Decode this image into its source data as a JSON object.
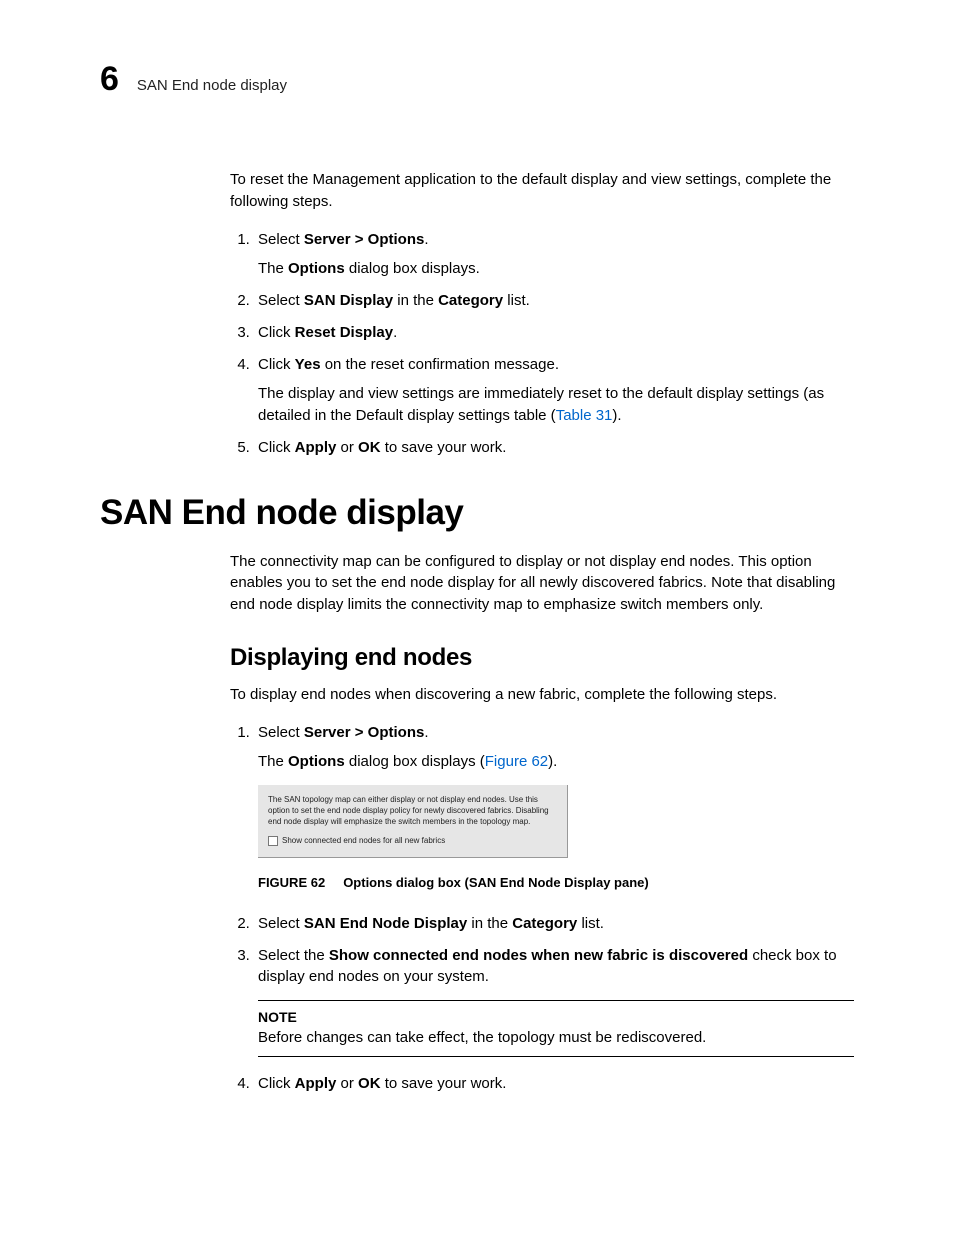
{
  "header": {
    "chapter_number": "6",
    "chapter_title": "SAN End node display"
  },
  "intro_para": "To reset the Management application to the default display and view settings, complete the following steps.",
  "steps_a": {
    "s1_pre": "Select ",
    "s1_bold": "Server > Options",
    "s1_post": ".",
    "s1_sub_pre": "The ",
    "s1_sub_bold": "Options",
    "s1_sub_post": " dialog box displays.",
    "s2_pre": "Select ",
    "s2_bold1": "SAN Display",
    "s2_mid": " in the ",
    "s2_bold2": "Category",
    "s2_post": " list.",
    "s3_pre": "Click ",
    "s3_bold": "Reset Display",
    "s3_post": ".",
    "s4_pre": "Click ",
    "s4_bold": "Yes",
    "s4_post": " on the reset confirmation message.",
    "s4_sub1": "The display and view settings are immediately reset to the default display settings (as detailed in the Default display settings table (",
    "s4_link": "Table 31",
    "s4_sub2": ").",
    "s5_pre": "Click ",
    "s5_bold1": "Apply",
    "s5_mid": " or ",
    "s5_bold2": "OK",
    "s5_post": " to save your work."
  },
  "section_h1": "SAN End node display",
  "section_para": "The connectivity map can be configured to display or not display end nodes. This option enables you to set the end node display for all newly discovered fabrics. Note that disabling end node display limits the connectivity map to emphasize switch members only.",
  "subsection_h2": "Displaying end nodes",
  "subsection_para": "To display end nodes when discovering a new fabric, complete the following steps.",
  "steps_b": {
    "s1_pre": "Select ",
    "s1_bold": "Server > Options",
    "s1_post": ".",
    "s1_sub_pre": "The ",
    "s1_sub_bold": "Options",
    "s1_sub_mid": " dialog box displays (",
    "s1_link": "Figure 62",
    "s1_sub_post": ").",
    "s2_pre": "Select ",
    "s2_bold1": "SAN End Node Display",
    "s2_mid": " in the ",
    "s2_bold2": "Category",
    "s2_post": " list.",
    "s3_pre": "Select the ",
    "s3_bold": "Show connected end nodes when new fabric is discovered",
    "s3_post": " check box to display end nodes on your system.",
    "s4_pre": "Click ",
    "s4_bold1": "Apply",
    "s4_mid": " or ",
    "s4_bold2": "OK",
    "s4_post": " to save your work."
  },
  "figure": {
    "body_text": "The SAN topology map can either display or not display end nodes. Use this option to set the end node display policy for newly discovered fabrics. Disabling end node display will emphasize the switch members in the topology map.",
    "checkbox_label": "Show connected end nodes for all new fabrics",
    "caption_label": "FIGURE 62",
    "caption_text": "Options dialog box (SAN End Node Display pane)"
  },
  "note": {
    "label": "NOTE",
    "text": "Before changes can take effect, the topology must be rediscovered."
  }
}
